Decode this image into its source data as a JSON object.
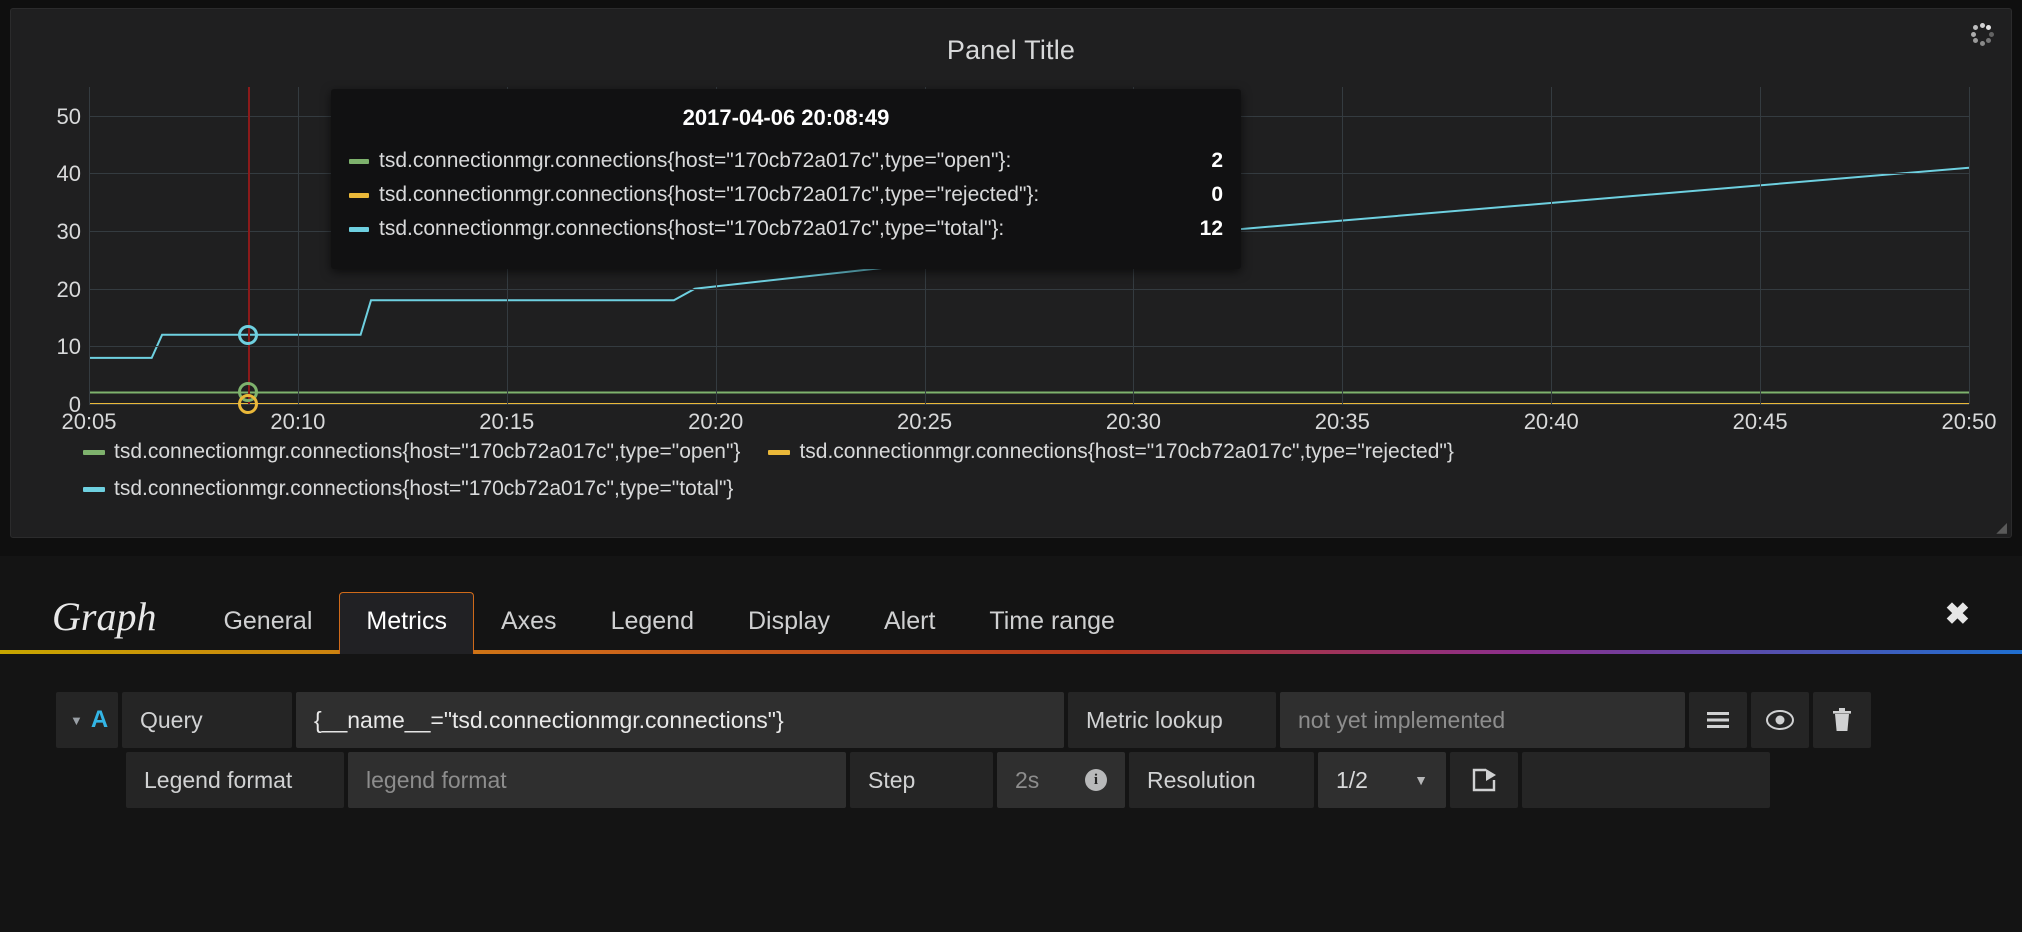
{
  "panel": {
    "title": "Panel Title",
    "spinner_icon": "loading-spinner-icon",
    "resize_handle_icon": "resize-grip-icon"
  },
  "series_colors": {
    "open": "#7eb26d",
    "rejected": "#eab839",
    "total": "#6ed0e0"
  },
  "tooltip": {
    "time": "2017-04-06 20:08:49",
    "rows": [
      {
        "color": "#7eb26d",
        "name": "tsd.connectionmgr.connections{host=\"170cb72a017c\",type=\"open\"}:",
        "value": "2"
      },
      {
        "color": "#eab839",
        "name": "tsd.connectionmgr.connections{host=\"170cb72a017c\",type=\"rejected\"}:",
        "value": "0"
      },
      {
        "color": "#6ed0e0",
        "name": "tsd.connectionmgr.connections{host=\"170cb72a017c\",type=\"total\"}:",
        "value": "12"
      }
    ]
  },
  "legend": {
    "items": [
      {
        "color": "#7eb26d",
        "label": "tsd.connectionmgr.connections{host=\"170cb72a017c\",type=\"open\"}"
      },
      {
        "color": "#eab839",
        "label": "tsd.connectionmgr.connections{host=\"170cb72a017c\",type=\"rejected\"}"
      },
      {
        "color": "#6ed0e0",
        "label": "tsd.connectionmgr.connections{host=\"170cb72a017c\",type=\"total\"}"
      }
    ]
  },
  "chart_data": {
    "type": "line",
    "title": "Panel Title",
    "xlabel": "",
    "ylabel": "",
    "ylim": [
      0,
      55
    ],
    "yticks": [
      0,
      10,
      20,
      30,
      40,
      50
    ],
    "xtick_labels": [
      "20:05",
      "20:10",
      "20:15",
      "20:20",
      "20:25",
      "20:30",
      "20:35",
      "20:40",
      "20:45",
      "20:50"
    ],
    "grid": true,
    "legend_position": "bottom",
    "crosshair_time": "20:08:49",
    "series": [
      {
        "name": "tsd.connectionmgr.connections{host=\"170cb72a017c\",type=\"open\"}",
        "color": "#7eb26d",
        "x": [
          "20:05",
          "20:08:49",
          "20:20",
          "20:35",
          "20:50"
        ],
        "values": [
          2,
          2,
          2,
          2,
          2
        ]
      },
      {
        "name": "tsd.connectionmgr.connections{host=\"170cb72a017c\",type=\"rejected\"}",
        "color": "#eab839",
        "x": [
          "20:05",
          "20:08:49",
          "20:20",
          "20:35",
          "20:50"
        ],
        "values": [
          0,
          0,
          0,
          0,
          0
        ]
      },
      {
        "name": "tsd.connectionmgr.connections{host=\"170cb72a017c\",type=\"total\"}",
        "color": "#6ed0e0",
        "x": [
          "20:05",
          "20:06:30",
          "20:06:45",
          "20:08:49",
          "20:11:30",
          "20:11:45",
          "20:19:00",
          "20:19:30",
          "20:32:00",
          "20:50"
        ],
        "values": [
          8,
          8,
          12,
          12,
          12,
          18,
          18,
          20,
          30,
          41
        ]
      }
    ]
  },
  "editor": {
    "title": "Graph",
    "close_icon": "close-icon",
    "tabs": [
      {
        "label": "General",
        "active": false
      },
      {
        "label": "Metrics",
        "active": true
      },
      {
        "label": "Axes",
        "active": false
      },
      {
        "label": "Legend",
        "active": false
      },
      {
        "label": "Display",
        "active": false
      },
      {
        "label": "Alert",
        "active": false
      },
      {
        "label": "Time range",
        "active": false
      }
    ],
    "query": {
      "ref_id": "A",
      "collapse_icon": "chevron-down-icon",
      "query_label": "Query",
      "query_value": "{__name__=\"tsd.connectionmgr.connections\"}",
      "metric_lookup_label": "Metric lookup",
      "metric_lookup_placeholder": "not yet implemented",
      "menu_icon": "hamburger-menu-icon",
      "eye_icon": "eye-icon",
      "trash_icon": "trash-icon",
      "legend_format_label": "Legend format",
      "legend_format_placeholder": "legend format",
      "step_label": "Step",
      "step_placeholder": "2s",
      "step_info_icon": "info-icon",
      "resolution_label": "Resolution",
      "resolution_value": "1/2",
      "resolution_caret_icon": "chevron-down-icon",
      "external_link_icon": "external-link-icon"
    }
  }
}
